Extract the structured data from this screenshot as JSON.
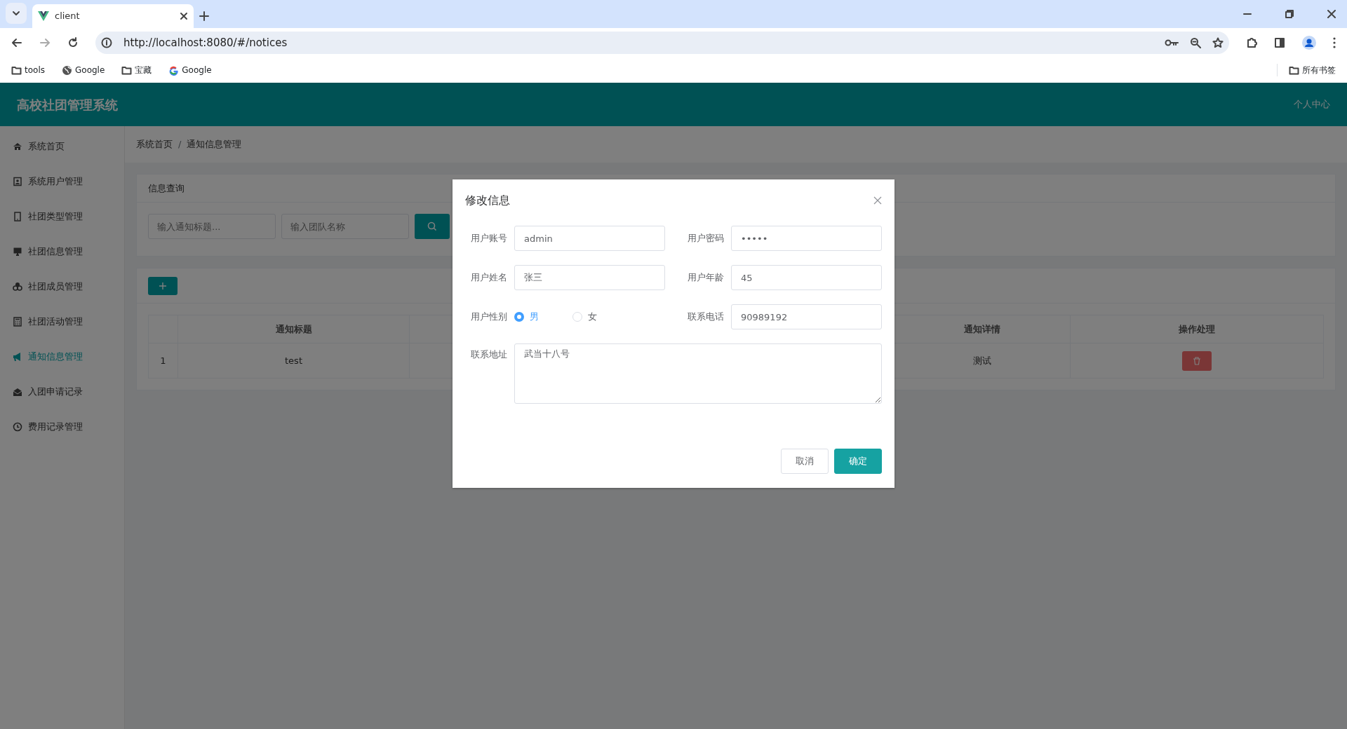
{
  "browser": {
    "tab_title": "client",
    "url": "http://localhost:8080/#/notices",
    "bookmarks": [
      {
        "label": "tools",
        "kind": "folder"
      },
      {
        "label": "Google",
        "kind": "globe"
      },
      {
        "label": "宝藏",
        "kind": "folder"
      },
      {
        "label": "Google",
        "kind": "google"
      }
    ],
    "all_bookmarks": "所有书签"
  },
  "app": {
    "title": "高校社团管理系统",
    "user_menu": "个人中心"
  },
  "sidebar": {
    "items": [
      {
        "label": "系统首页",
        "selected": false
      },
      {
        "label": "系统用户管理",
        "selected": false
      },
      {
        "label": "社团类型管理",
        "selected": false
      },
      {
        "label": "社团信息管理",
        "selected": false
      },
      {
        "label": "社团成员管理",
        "selected": false
      },
      {
        "label": "社团活动管理",
        "selected": false
      },
      {
        "label": "通知信息管理",
        "selected": true
      },
      {
        "label": "入团申请记录",
        "selected": false
      },
      {
        "label": "费用记录管理",
        "selected": false
      }
    ]
  },
  "breadcrumb": [
    "系统首页",
    "通知信息管理"
  ],
  "breadcrumb_separator": "/",
  "search": {
    "title": "信息查询",
    "fields": [
      {
        "placeholder": "输入通知标题..."
      },
      {
        "placeholder": "输入团队名称"
      }
    ]
  },
  "table": {
    "columns": [
      "通知标题",
      "通知详情",
      "操作处理"
    ],
    "rows": [
      {
        "index": "1",
        "title": "test",
        "detail": "测试"
      }
    ]
  },
  "dialog": {
    "title": "修改信息",
    "fields": [
      {
        "kind": "text",
        "label": "用户账号",
        "value": "admin"
      },
      {
        "kind": "text",
        "label": "用户密码",
        "value": "•••••"
      },
      {
        "kind": "text",
        "label": "用户姓名",
        "value": "张三"
      },
      {
        "kind": "text",
        "label": "用户年龄",
        "value": "45"
      },
      {
        "kind": "radio",
        "label": "用户性别",
        "options": [
          {
            "label": "男",
            "selected": true
          },
          {
            "label": "女",
            "selected": false
          }
        ]
      },
      {
        "kind": "text",
        "label": "联系电话",
        "value": "90989192"
      },
      {
        "kind": "textarea",
        "label": "联系地址",
        "value": "武当十八号"
      }
    ],
    "buttons": [
      {
        "label": "取消",
        "kind": "secondary"
      },
      {
        "label": "确定",
        "kind": "primary"
      }
    ]
  }
}
